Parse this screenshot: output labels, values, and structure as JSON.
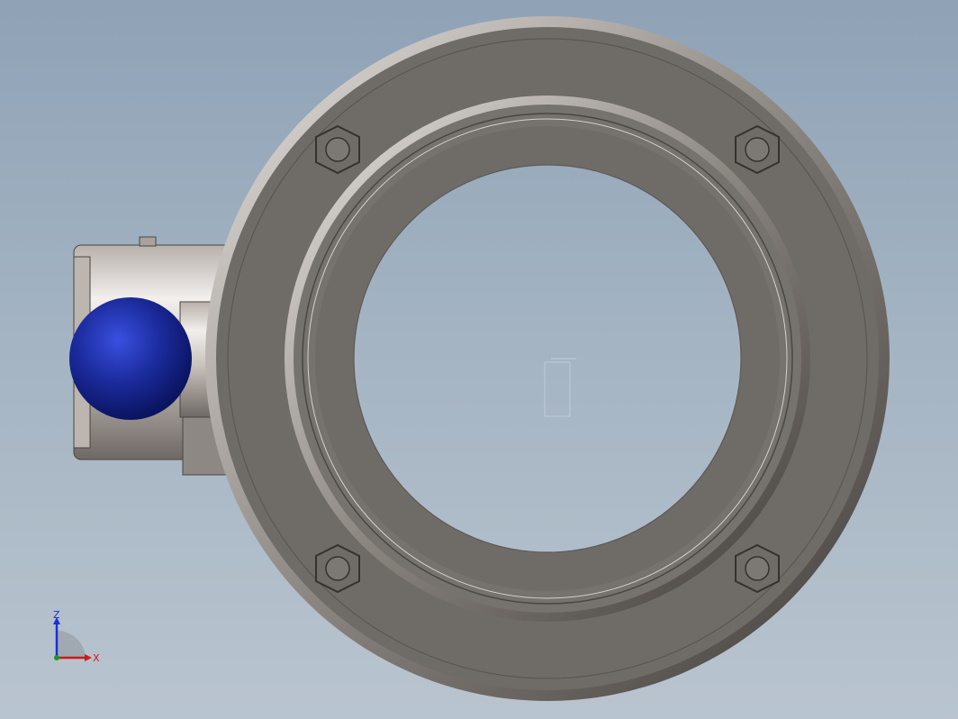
{
  "scene": {
    "background_top": "#8fa2b6",
    "background_bottom": "#b9c4cf",
    "part_color": "#6f6c68",
    "handle_color": "#1a2a9a"
  },
  "triad": {
    "z_label": "Z",
    "x_label": "X",
    "z_color": "#1b2fd6",
    "x_color": "#d01818",
    "y_color": "#1a9a1a"
  }
}
